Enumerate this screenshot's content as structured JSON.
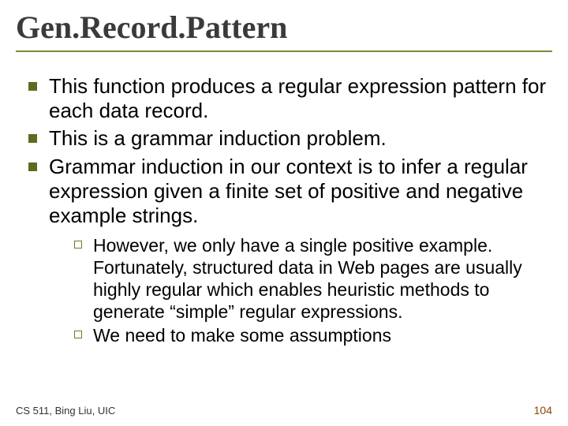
{
  "title": "Gen.Record.Pattern",
  "bullets": [
    "This function produces a regular expression pattern for each data record.",
    "This is a grammar induction problem.",
    "Grammar induction in our context is to infer a regular expression given a finite set of positive and negative example strings."
  ],
  "subbullets": [
    "However, we only have a single positive example. Fortunately, structured data in Web pages are usually highly regular which enables heuristic methods to generate “simple” regular expressions.",
    "We need to make some assumptions"
  ],
  "footer": {
    "left": "CS 511, Bing Liu, UIC",
    "page": "104"
  }
}
